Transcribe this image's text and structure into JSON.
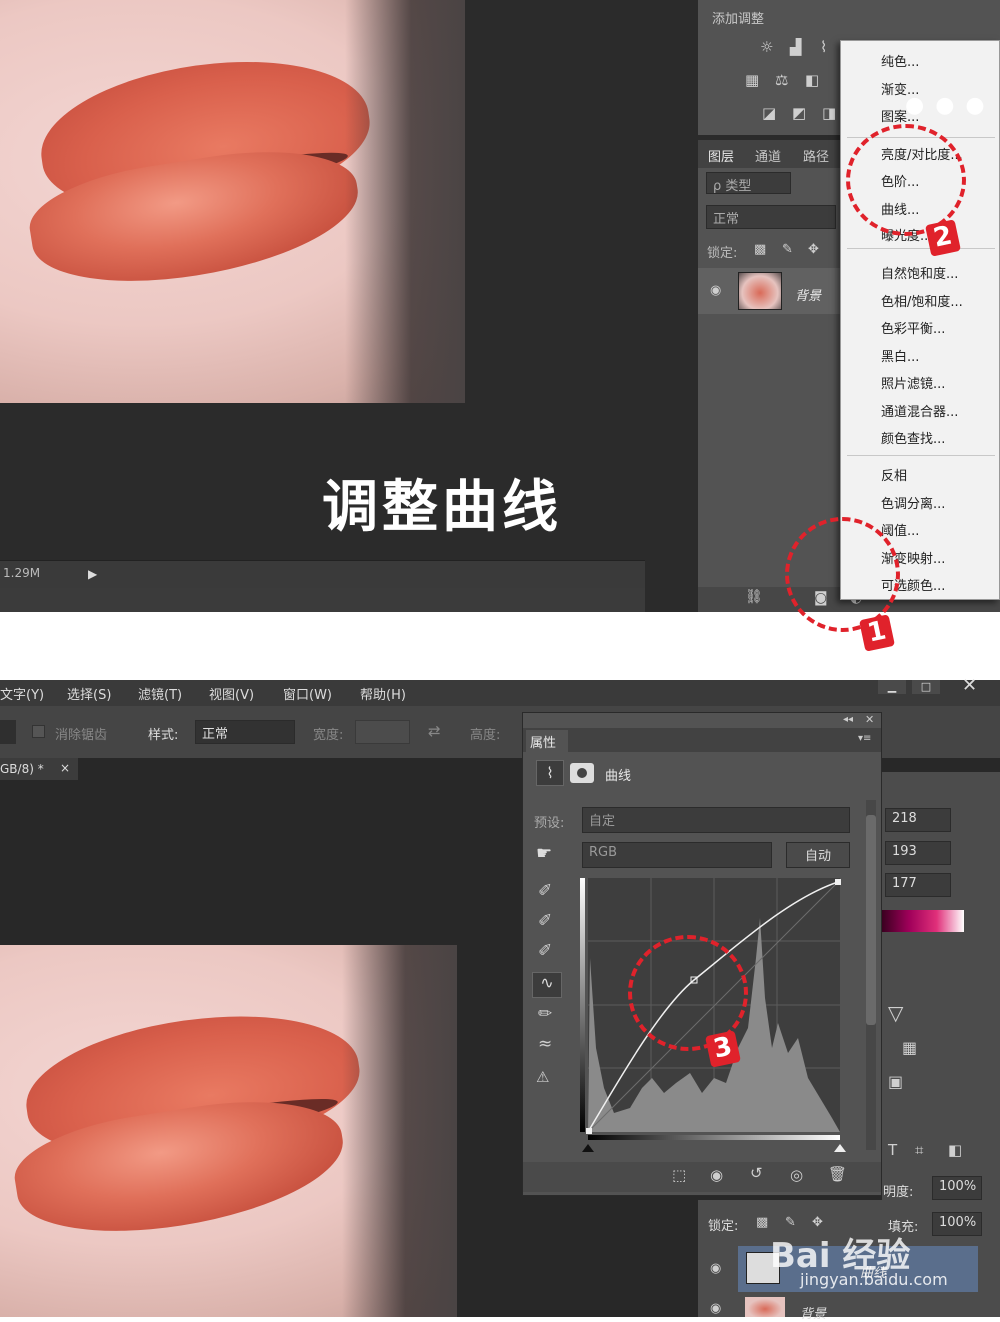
{
  "top": {
    "adjust_panel_title": "添加调整",
    "layers_tabs": [
      "图层",
      "通道",
      "路径"
    ],
    "kind_filter": "ρ 类型",
    "blend_mode": "正常",
    "lock_label": "锁定:",
    "layer_name": "背景",
    "doc_size": "1.29M",
    "caption": "调整曲线",
    "menu_items": [
      "纯色...",
      "渐变...",
      "图案...",
      "亮度/对比度...",
      "色阶...",
      "曲线...",
      "曝光度...",
      "自然饱和度...",
      "色相/饱和度...",
      "色彩平衡...",
      "黑白...",
      "照片滤镜...",
      "通道混合器...",
      "颜色查找...",
      "反相",
      "色调分离...",
      "阈值...",
      "渐变映射...",
      "可选颜色..."
    ],
    "markers": [
      "1",
      "2"
    ]
  },
  "bottom": {
    "menubar": [
      "文字(Y)",
      "选择(S)",
      "滤镜(T)",
      "视图(V)",
      "窗口(W)",
      "帮助(H)"
    ],
    "options": {
      "antialias": "消除锯齿",
      "style_label": "样式:",
      "style_value": "正常",
      "width_label": "宽度:",
      "height_label": "高度:"
    },
    "doc_tab": "GB/8) *",
    "props": {
      "tab": "属性",
      "type": "曲线",
      "preset_label": "预设:",
      "preset_value": "自定",
      "channel": "RGB",
      "auto": "自动"
    },
    "rgb_values": [
      "218",
      "193",
      "177"
    ],
    "opacity_label": "明度:",
    "opacity_value": "100%",
    "lock_label": "锁定:",
    "fill_label": "填充:",
    "fill_value": "100%",
    "layer_curves": "曲线",
    "layer_bg": "背景",
    "marker": "3",
    "watermark": "Bai 经验",
    "watermark_url": "jingyan.baidu.com"
  },
  "colors": {
    "accent_red": "#e0222b",
    "panel": "#535353",
    "canvas": "#282828"
  }
}
